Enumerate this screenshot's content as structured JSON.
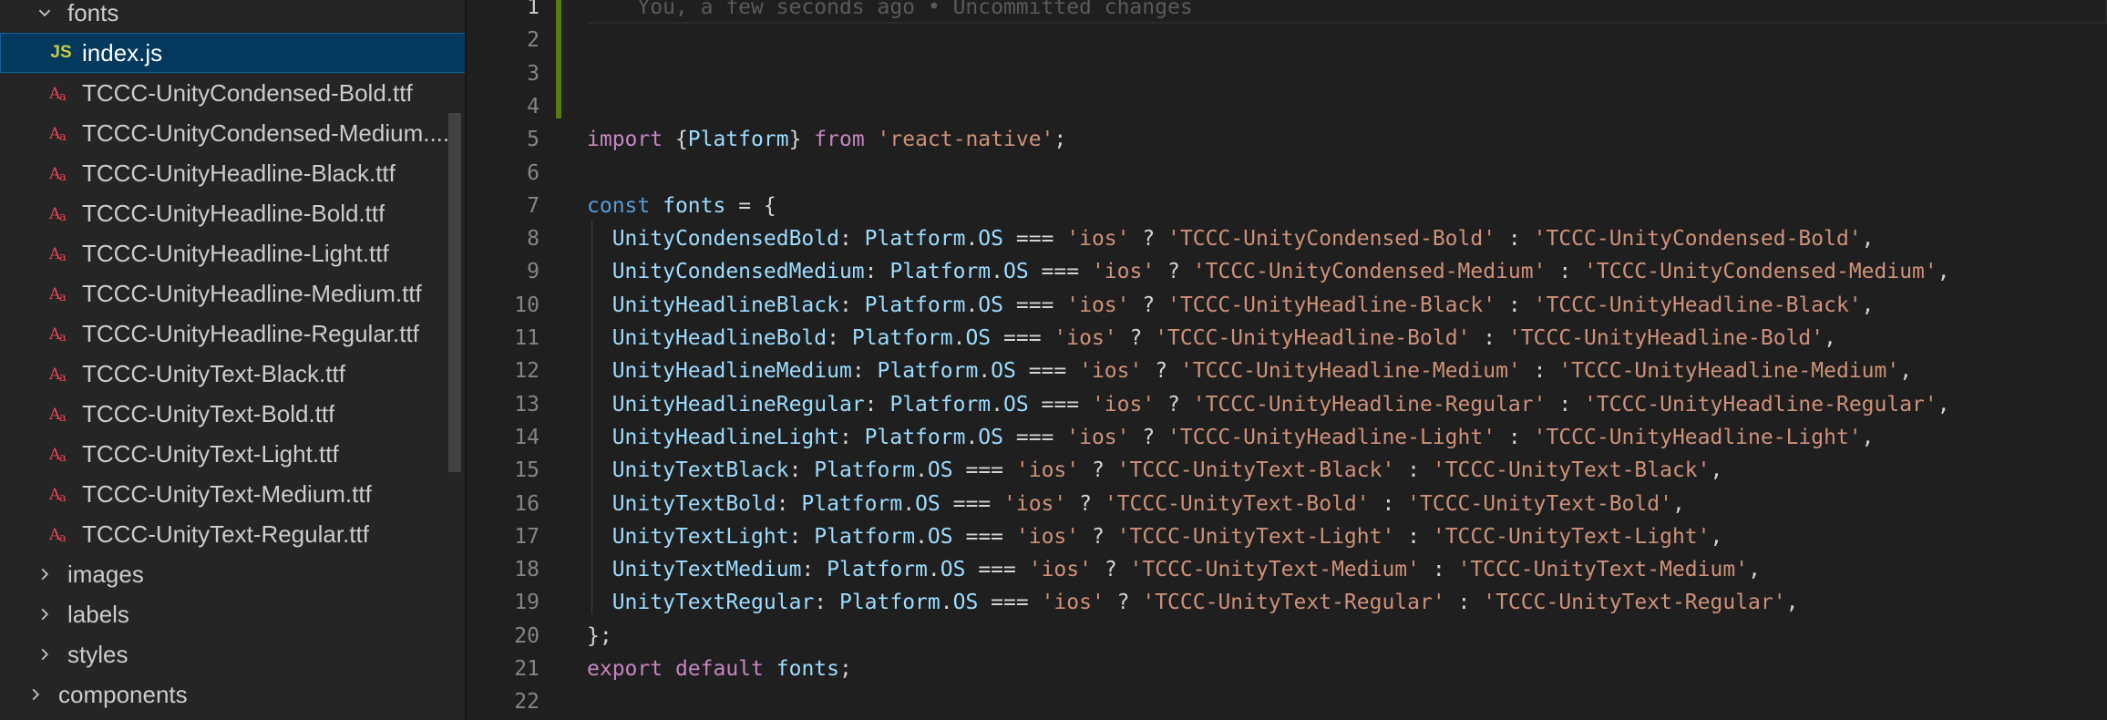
{
  "explorer": {
    "items": [
      {
        "label": "fonts",
        "type": "folder",
        "expanded": true,
        "indent": 1,
        "icon": "chevron-down-icon"
      },
      {
        "label": "index.js",
        "type": "file",
        "file_icon": "js-icon",
        "icon_text": "JS",
        "indent": 2,
        "selected": true
      },
      {
        "label": "TCCC-UnityCondensed-Bold.ttf",
        "type": "file",
        "file_icon": "font-file-icon",
        "indent": 2
      },
      {
        "label": "TCCC-UnityCondensed-Medium....",
        "type": "file",
        "file_icon": "font-file-icon",
        "indent": 2
      },
      {
        "label": "TCCC-UnityHeadline-Black.ttf",
        "type": "file",
        "file_icon": "font-file-icon",
        "indent": 2
      },
      {
        "label": "TCCC-UnityHeadline-Bold.ttf",
        "type": "file",
        "file_icon": "font-file-icon",
        "indent": 2
      },
      {
        "label": "TCCC-UnityHeadline-Light.ttf",
        "type": "file",
        "file_icon": "font-file-icon",
        "indent": 2
      },
      {
        "label": "TCCC-UnityHeadline-Medium.ttf",
        "type": "file",
        "file_icon": "font-file-icon",
        "indent": 2
      },
      {
        "label": "TCCC-UnityHeadline-Regular.ttf",
        "type": "file",
        "file_icon": "font-file-icon",
        "indent": 2
      },
      {
        "label": "TCCC-UnityText-Black.ttf",
        "type": "file",
        "file_icon": "font-file-icon",
        "indent": 2
      },
      {
        "label": "TCCC-UnityText-Bold.ttf",
        "type": "file",
        "file_icon": "font-file-icon",
        "indent": 2
      },
      {
        "label": "TCCC-UnityText-Light.ttf",
        "type": "file",
        "file_icon": "font-file-icon",
        "indent": 2
      },
      {
        "label": "TCCC-UnityText-Medium.ttf",
        "type": "file",
        "file_icon": "font-file-icon",
        "indent": 2
      },
      {
        "label": "TCCC-UnityText-Regular.ttf",
        "type": "file",
        "file_icon": "font-file-icon",
        "indent": 2
      },
      {
        "label": "images",
        "type": "folder",
        "expanded": false,
        "indent": 1,
        "icon": "chevron-right-icon"
      },
      {
        "label": "labels",
        "type": "folder",
        "expanded": false,
        "indent": 1,
        "icon": "chevron-right-icon"
      },
      {
        "label": "styles",
        "type": "folder",
        "expanded": false,
        "indent": 1,
        "icon": "chevron-right-icon"
      },
      {
        "label": "components",
        "type": "folder",
        "expanded": false,
        "indent": 0,
        "icon": "chevron-right-icon"
      }
    ]
  },
  "editor": {
    "blame": "You, a few seconds ago • Uncommitted changes",
    "colors": {
      "keyword": "#c586c0",
      "string": "#ce9178",
      "variable": "#9cdcfe",
      "storage": "#569cd6",
      "text": "#d4d4d4",
      "modified_bar": "#587c0c"
    },
    "line_numbers": [
      "1",
      "2",
      "3",
      "4",
      "5",
      "6",
      "7",
      "8",
      "9",
      "10",
      "11",
      "12",
      "13",
      "14",
      "15",
      "16",
      "17",
      "18",
      "19",
      "20",
      "21",
      "22"
    ],
    "lines": [
      [
        {
          "t": "blame",
          "v": "    You, a few seconds ago • Uncommitted changes"
        }
      ],
      [],
      [],
      [],
      [
        {
          "t": "kw",
          "v": "import"
        },
        {
          "t": "tx",
          "v": " {"
        },
        {
          "t": "vr",
          "v": "Platform"
        },
        {
          "t": "tx",
          "v": "} "
        },
        {
          "t": "kw",
          "v": "from"
        },
        {
          "t": "tx",
          "v": " "
        },
        {
          "t": "st",
          "v": "'react-native'"
        },
        {
          "t": "tx",
          "v": ";"
        }
      ],
      [],
      [
        {
          "t": "sk",
          "v": "const"
        },
        {
          "t": "tx",
          "v": " "
        },
        {
          "t": "vr",
          "v": "fonts"
        },
        {
          "t": "tx",
          "v": " = {"
        }
      ],
      [
        {
          "t": "tx",
          "v": "  "
        },
        {
          "t": "vr",
          "v": "UnityCondensedBold"
        },
        {
          "t": "tx",
          "v": ": "
        },
        {
          "t": "vr",
          "v": "Platform"
        },
        {
          "t": "tx",
          "v": "."
        },
        {
          "t": "vr",
          "v": "OS"
        },
        {
          "t": "tx",
          "v": " === "
        },
        {
          "t": "st",
          "v": "'ios'"
        },
        {
          "t": "tx",
          "v": " ? "
        },
        {
          "t": "st",
          "v": "'TCCC-UnityCondensed-Bold'"
        },
        {
          "t": "tx",
          "v": " : "
        },
        {
          "t": "st",
          "v": "'TCCC-UnityCondensed-Bold'"
        },
        {
          "t": "tx",
          "v": ","
        }
      ],
      [
        {
          "t": "tx",
          "v": "  "
        },
        {
          "t": "vr",
          "v": "UnityCondensedMedium"
        },
        {
          "t": "tx",
          "v": ": "
        },
        {
          "t": "vr",
          "v": "Platform"
        },
        {
          "t": "tx",
          "v": "."
        },
        {
          "t": "vr",
          "v": "OS"
        },
        {
          "t": "tx",
          "v": " === "
        },
        {
          "t": "st",
          "v": "'ios'"
        },
        {
          "t": "tx",
          "v": " ? "
        },
        {
          "t": "st",
          "v": "'TCCC-UnityCondensed-Medium'"
        },
        {
          "t": "tx",
          "v": " : "
        },
        {
          "t": "st",
          "v": "'TCCC-UnityCondensed-Medium'"
        },
        {
          "t": "tx",
          "v": ","
        }
      ],
      [
        {
          "t": "tx",
          "v": "  "
        },
        {
          "t": "vr",
          "v": "UnityHeadlineBlack"
        },
        {
          "t": "tx",
          "v": ": "
        },
        {
          "t": "vr",
          "v": "Platform"
        },
        {
          "t": "tx",
          "v": "."
        },
        {
          "t": "vr",
          "v": "OS"
        },
        {
          "t": "tx",
          "v": " === "
        },
        {
          "t": "st",
          "v": "'ios'"
        },
        {
          "t": "tx",
          "v": " ? "
        },
        {
          "t": "st",
          "v": "'TCCC-UnityHeadline-Black'"
        },
        {
          "t": "tx",
          "v": " : "
        },
        {
          "t": "st",
          "v": "'TCCC-UnityHeadline-Black'"
        },
        {
          "t": "tx",
          "v": ","
        }
      ],
      [
        {
          "t": "tx",
          "v": "  "
        },
        {
          "t": "vr",
          "v": "UnityHeadlineBold"
        },
        {
          "t": "tx",
          "v": ": "
        },
        {
          "t": "vr",
          "v": "Platform"
        },
        {
          "t": "tx",
          "v": "."
        },
        {
          "t": "vr",
          "v": "OS"
        },
        {
          "t": "tx",
          "v": " === "
        },
        {
          "t": "st",
          "v": "'ios'"
        },
        {
          "t": "tx",
          "v": " ? "
        },
        {
          "t": "st",
          "v": "'TCCC-UnityHeadline-Bold'"
        },
        {
          "t": "tx",
          "v": " : "
        },
        {
          "t": "st",
          "v": "'TCCC-UnityHeadline-Bold'"
        },
        {
          "t": "tx",
          "v": ","
        }
      ],
      [
        {
          "t": "tx",
          "v": "  "
        },
        {
          "t": "vr",
          "v": "UnityHeadlineMedium"
        },
        {
          "t": "tx",
          "v": ": "
        },
        {
          "t": "vr",
          "v": "Platform"
        },
        {
          "t": "tx",
          "v": "."
        },
        {
          "t": "vr",
          "v": "OS"
        },
        {
          "t": "tx",
          "v": " === "
        },
        {
          "t": "st",
          "v": "'ios'"
        },
        {
          "t": "tx",
          "v": " ? "
        },
        {
          "t": "st",
          "v": "'TCCC-UnityHeadline-Medium'"
        },
        {
          "t": "tx",
          "v": " : "
        },
        {
          "t": "st",
          "v": "'TCCC-UnityHeadline-Medium'"
        },
        {
          "t": "tx",
          "v": ","
        }
      ],
      [
        {
          "t": "tx",
          "v": "  "
        },
        {
          "t": "vr",
          "v": "UnityHeadlineRegular"
        },
        {
          "t": "tx",
          "v": ": "
        },
        {
          "t": "vr",
          "v": "Platform"
        },
        {
          "t": "tx",
          "v": "."
        },
        {
          "t": "vr",
          "v": "OS"
        },
        {
          "t": "tx",
          "v": " === "
        },
        {
          "t": "st",
          "v": "'ios'"
        },
        {
          "t": "tx",
          "v": " ? "
        },
        {
          "t": "st",
          "v": "'TCCC-UnityHeadline-Regular'"
        },
        {
          "t": "tx",
          "v": " : "
        },
        {
          "t": "st",
          "v": "'TCCC-UnityHeadline-Regular'"
        },
        {
          "t": "tx",
          "v": ","
        }
      ],
      [
        {
          "t": "tx",
          "v": "  "
        },
        {
          "t": "vr",
          "v": "UnityHeadlineLight"
        },
        {
          "t": "tx",
          "v": ": "
        },
        {
          "t": "vr",
          "v": "Platform"
        },
        {
          "t": "tx",
          "v": "."
        },
        {
          "t": "vr",
          "v": "OS"
        },
        {
          "t": "tx",
          "v": " === "
        },
        {
          "t": "st",
          "v": "'ios'"
        },
        {
          "t": "tx",
          "v": " ? "
        },
        {
          "t": "st",
          "v": "'TCCC-UnityHeadline-Light'"
        },
        {
          "t": "tx",
          "v": " : "
        },
        {
          "t": "st",
          "v": "'TCCC-UnityHeadline-Light'"
        },
        {
          "t": "tx",
          "v": ","
        }
      ],
      [
        {
          "t": "tx",
          "v": "  "
        },
        {
          "t": "vr",
          "v": "UnityTextBlack"
        },
        {
          "t": "tx",
          "v": ": "
        },
        {
          "t": "vr",
          "v": "Platform"
        },
        {
          "t": "tx",
          "v": "."
        },
        {
          "t": "vr",
          "v": "OS"
        },
        {
          "t": "tx",
          "v": " === "
        },
        {
          "t": "st",
          "v": "'ios'"
        },
        {
          "t": "tx",
          "v": " ? "
        },
        {
          "t": "st",
          "v": "'TCCC-UnityText-Black'"
        },
        {
          "t": "tx",
          "v": " : "
        },
        {
          "t": "st",
          "v": "'TCCC-UnityText-Black'"
        },
        {
          "t": "tx",
          "v": ","
        }
      ],
      [
        {
          "t": "tx",
          "v": "  "
        },
        {
          "t": "vr",
          "v": "UnityTextBold"
        },
        {
          "t": "tx",
          "v": ": "
        },
        {
          "t": "vr",
          "v": "Platform"
        },
        {
          "t": "tx",
          "v": "."
        },
        {
          "t": "vr",
          "v": "OS"
        },
        {
          "t": "tx",
          "v": " === "
        },
        {
          "t": "st",
          "v": "'ios'"
        },
        {
          "t": "tx",
          "v": " ? "
        },
        {
          "t": "st",
          "v": "'TCCC-UnityText-Bold'"
        },
        {
          "t": "tx",
          "v": " : "
        },
        {
          "t": "st",
          "v": "'TCCC-UnityText-Bold'"
        },
        {
          "t": "tx",
          "v": ","
        }
      ],
      [
        {
          "t": "tx",
          "v": "  "
        },
        {
          "t": "vr",
          "v": "UnityTextLight"
        },
        {
          "t": "tx",
          "v": ": "
        },
        {
          "t": "vr",
          "v": "Platform"
        },
        {
          "t": "tx",
          "v": "."
        },
        {
          "t": "vr",
          "v": "OS"
        },
        {
          "t": "tx",
          "v": " === "
        },
        {
          "t": "st",
          "v": "'ios'"
        },
        {
          "t": "tx",
          "v": " ? "
        },
        {
          "t": "st",
          "v": "'TCCC-UnityText-Light'"
        },
        {
          "t": "tx",
          "v": " : "
        },
        {
          "t": "st",
          "v": "'TCCC-UnityText-Light'"
        },
        {
          "t": "tx",
          "v": ","
        }
      ],
      [
        {
          "t": "tx",
          "v": "  "
        },
        {
          "t": "vr",
          "v": "UnityTextMedium"
        },
        {
          "t": "tx",
          "v": ": "
        },
        {
          "t": "vr",
          "v": "Platform"
        },
        {
          "t": "tx",
          "v": "."
        },
        {
          "t": "vr",
          "v": "OS"
        },
        {
          "t": "tx",
          "v": " === "
        },
        {
          "t": "st",
          "v": "'ios'"
        },
        {
          "t": "tx",
          "v": " ? "
        },
        {
          "t": "st",
          "v": "'TCCC-UnityText-Medium'"
        },
        {
          "t": "tx",
          "v": " : "
        },
        {
          "t": "st",
          "v": "'TCCC-UnityText-Medium'"
        },
        {
          "t": "tx",
          "v": ","
        }
      ],
      [
        {
          "t": "tx",
          "v": "  "
        },
        {
          "t": "vr",
          "v": "UnityTextRegular"
        },
        {
          "t": "tx",
          "v": ": "
        },
        {
          "t": "vr",
          "v": "Platform"
        },
        {
          "t": "tx",
          "v": "."
        },
        {
          "t": "vr",
          "v": "OS"
        },
        {
          "t": "tx",
          "v": " === "
        },
        {
          "t": "st",
          "v": "'ios'"
        },
        {
          "t": "tx",
          "v": " ? "
        },
        {
          "t": "st",
          "v": "'TCCC-UnityText-Regular'"
        },
        {
          "t": "tx",
          "v": " : "
        },
        {
          "t": "st",
          "v": "'TCCC-UnityText-Regular'"
        },
        {
          "t": "tx",
          "v": ","
        }
      ],
      [
        {
          "t": "tx",
          "v": "};"
        }
      ],
      [
        {
          "t": "kw",
          "v": "export"
        },
        {
          "t": "tx",
          "v": " "
        },
        {
          "t": "kw",
          "v": "default"
        },
        {
          "t": "tx",
          "v": " "
        },
        {
          "t": "vr",
          "v": "fonts"
        },
        {
          "t": "tx",
          "v": ";"
        }
      ],
      []
    ]
  }
}
